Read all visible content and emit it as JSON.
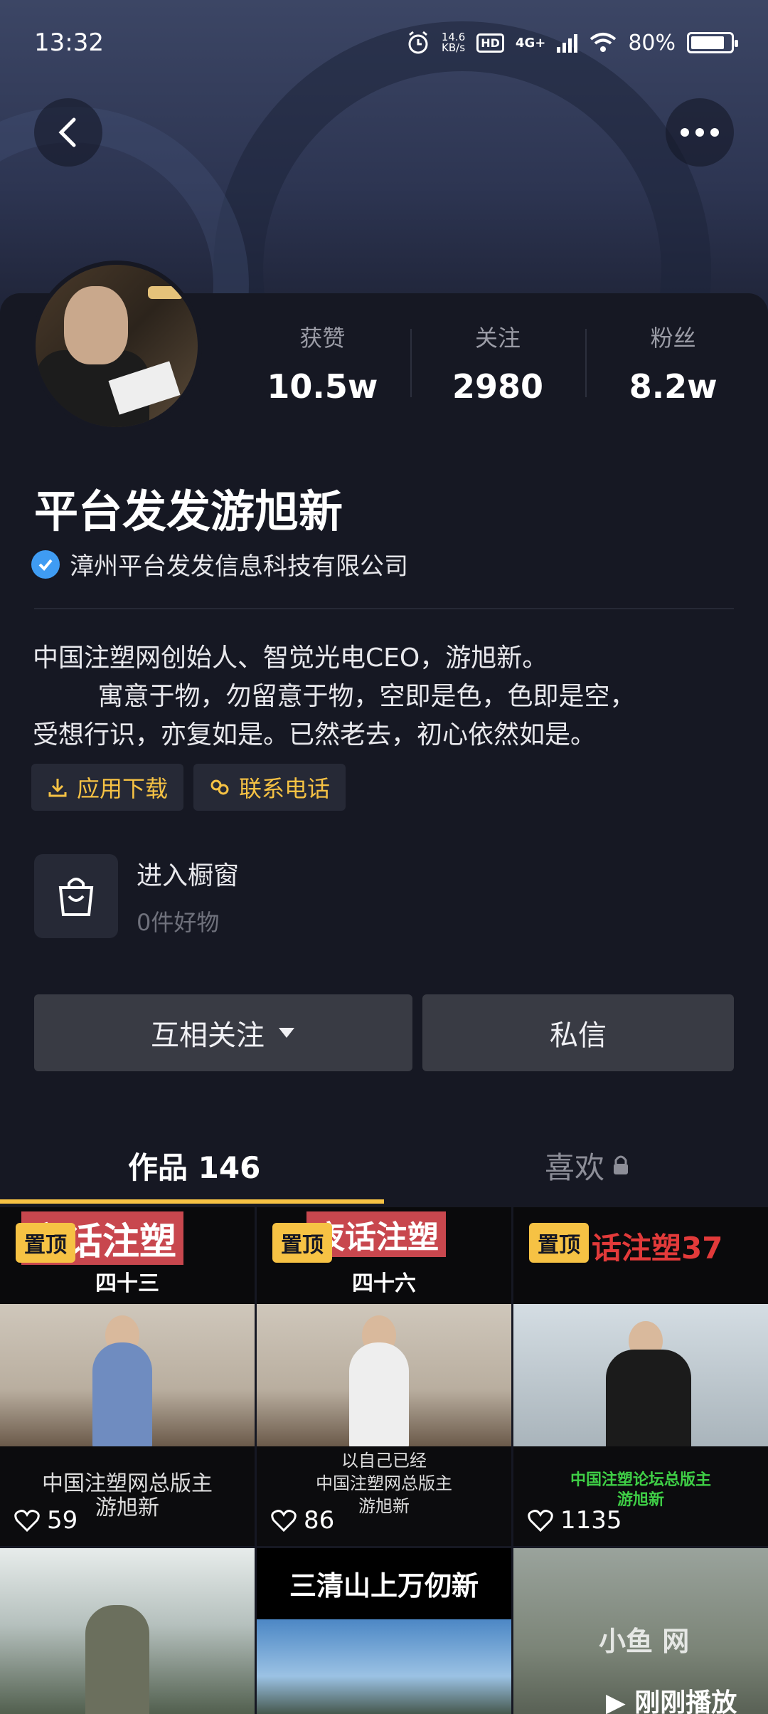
{
  "status_bar": {
    "time": "13:32",
    "net_speed_value": "14.6",
    "net_speed_unit": "KB/s",
    "hd": "HD",
    "network": "4G+",
    "battery": "80%"
  },
  "header": {
    "back_icon": "chevron-left-icon",
    "more_icon": "more-dots-icon"
  },
  "profile": {
    "name": "平台发发游旭新",
    "verified_org": "漳州平台发发信息科技有限公司",
    "stats": [
      {
        "label": "获赞",
        "value": "10.5w"
      },
      {
        "label": "关注",
        "value": "2980"
      },
      {
        "label": "粉丝",
        "value": "8.2w"
      }
    ],
    "bio": "中国注塑网创始人、智觉光电CEO，游旭新。\n        寓意于物，勿留意于物，空即是色，色即是空，\n受想行识，亦复如是。已然老去，初心依然如是。",
    "tags": [
      {
        "label": "应用下载",
        "icon": "download-icon"
      },
      {
        "label": "联系电话",
        "icon": "phone-link-icon"
      }
    ]
  },
  "shop": {
    "title": "进入橱窗",
    "subtitle": "0件好物"
  },
  "actions": {
    "follow_label": "互相关注",
    "message_label": "私信"
  },
  "tabs": {
    "works": "作品 146",
    "likes": "喜欢"
  },
  "videos": [
    {
      "pinned": "置顶",
      "title": "夜话注塑",
      "sub": "四十三",
      "caption": "中国注塑网总版主\n游旭新",
      "likes": "59"
    },
    {
      "pinned": "置顶",
      "title": "夜话注塑",
      "sub": "四十六",
      "caption": "以自己已经\n中国注塑网总版主\n游旭新",
      "likes": "86"
    },
    {
      "pinned": "置顶",
      "title": "话注塑37",
      "caption": "中国注塑论坛总版主\n游旭新",
      "likes": "1135"
    },
    {
      "title": ""
    },
    {
      "title": "三清山上万仞新"
    },
    {
      "play_label": "▶ 刚刚播放",
      "watermark": "小鱼 网"
    }
  ],
  "colors": {
    "background": "#161823",
    "accent_yellow": "#f6c244",
    "verify_blue": "#3f9cf3",
    "button_gray": "#393b44"
  }
}
